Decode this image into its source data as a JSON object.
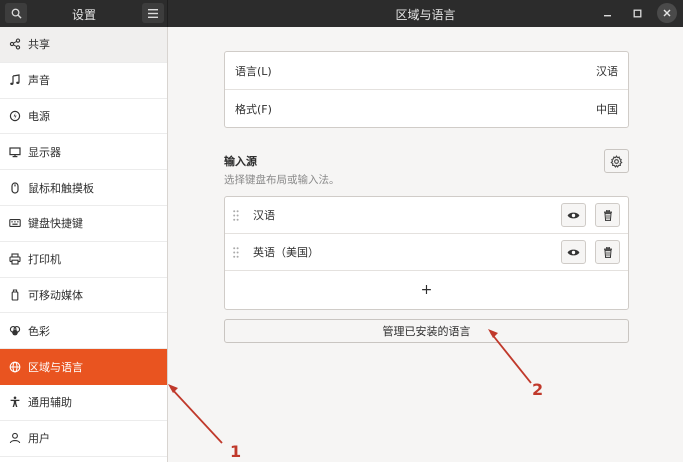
{
  "window": {
    "sidebar_title": "设置",
    "main_title": "区域与语言"
  },
  "sidebar": {
    "items": [
      {
        "label": "共享",
        "icon": "share-icon"
      },
      {
        "label": "声音",
        "icon": "music-note-icon"
      },
      {
        "label": "电源",
        "icon": "power-icon"
      },
      {
        "label": "显示器",
        "icon": "display-icon"
      },
      {
        "label": "鼠标和触摸板",
        "icon": "mouse-icon"
      },
      {
        "label": "键盘快捷键",
        "icon": "keyboard-icon"
      },
      {
        "label": "打印机",
        "icon": "printer-icon"
      },
      {
        "label": "可移动媒体",
        "icon": "removable-media-icon"
      },
      {
        "label": "色彩",
        "icon": "palette-icon"
      },
      {
        "label": "区域与语言",
        "icon": "globe-icon",
        "active": true
      },
      {
        "label": "通用辅助",
        "icon": "accessibility-icon"
      },
      {
        "label": "用户",
        "icon": "user-icon"
      }
    ]
  },
  "language": {
    "language_label": "语言(L)",
    "language_value": "汉语",
    "formats_label": "格式(F)",
    "formats_value": "中国"
  },
  "input_sources": {
    "title": "输入源",
    "subtitle": "选择键盘布局或输入法。",
    "items": [
      {
        "label": "汉语"
      },
      {
        "label": "英语（美国）"
      }
    ],
    "add_label": "+"
  },
  "manage_button": "管理已安装的语言",
  "annotations": {
    "label_1": "1",
    "label_2": "2",
    "color": "#c0392b"
  },
  "colors": {
    "accent": "#e95420",
    "headerbar": "#2c2c2c"
  }
}
